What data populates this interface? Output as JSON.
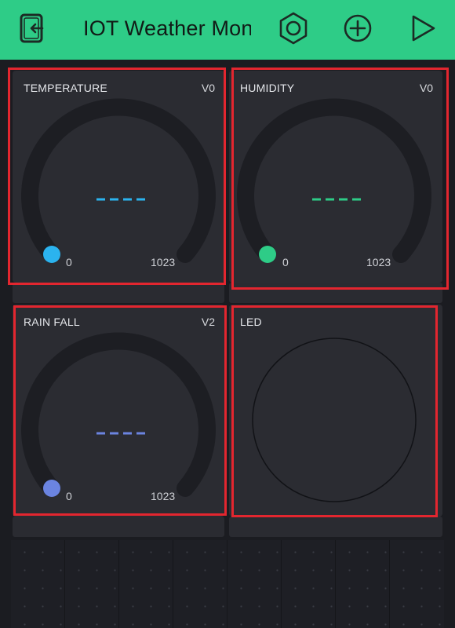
{
  "app": {
    "title": "IOT Weather Monit",
    "accent": "#2ecc87",
    "highlight_color": "#e3262f",
    "icons": [
      "exit-icon",
      "settings-hexagon-icon",
      "add-widget-icon",
      "play-icon"
    ]
  },
  "widgets": {
    "temperature": {
      "label": "TEMPERATURE",
      "pin": "V0",
      "value": "----",
      "min": "0",
      "max": "1023",
      "color": "#2bb3ef"
    },
    "humidity": {
      "label": "HUMIDITY",
      "pin": "V0",
      "value": "----",
      "min": "0",
      "max": "1023",
      "color": "#2ecc87"
    },
    "rainfall": {
      "label": "RAIN FALL",
      "pin": "V2",
      "value": "----",
      "min": "0",
      "max": "1023",
      "color": "#6b84e0"
    },
    "led": {
      "label": "LED"
    }
  }
}
